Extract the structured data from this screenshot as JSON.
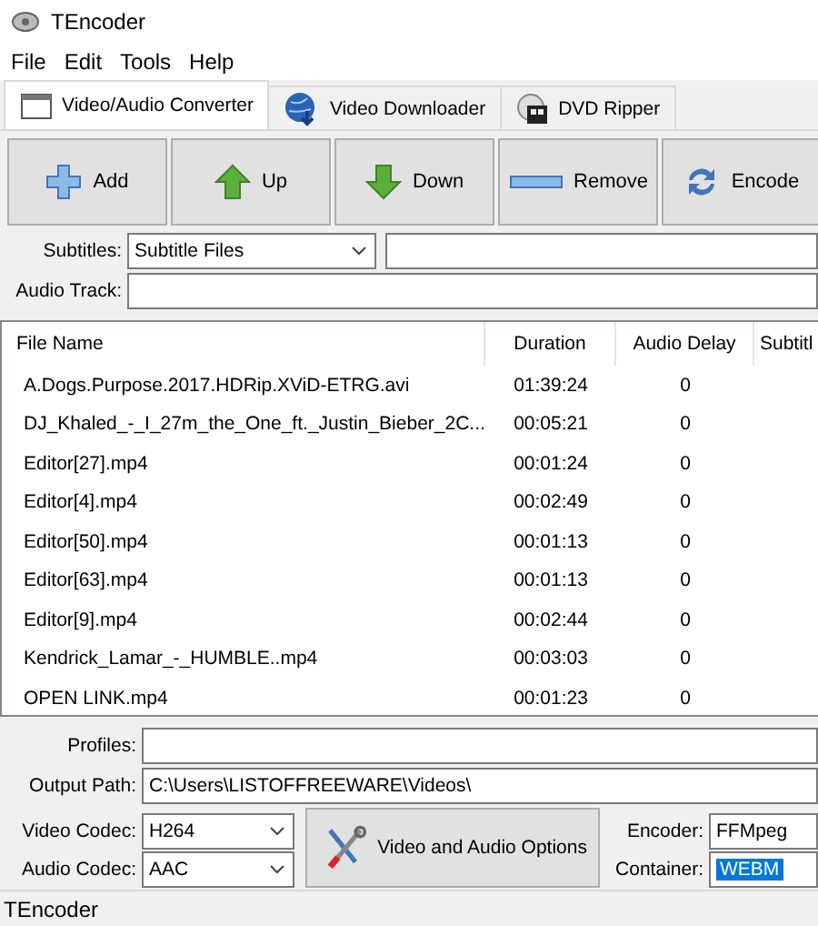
{
  "window": {
    "title": "TEncoder"
  },
  "menu": [
    "File",
    "Edit",
    "Tools",
    "Help"
  ],
  "tabs": [
    {
      "label": "Video/Audio Converter",
      "selected": true
    },
    {
      "label": "Video Downloader",
      "selected": false
    },
    {
      "label": "DVD Ripper",
      "selected": false
    }
  ],
  "toolbar": [
    {
      "label": "Add"
    },
    {
      "label": "Up"
    },
    {
      "label": "Down"
    },
    {
      "label": "Remove"
    },
    {
      "label": "Encode"
    }
  ],
  "subtitles": {
    "label": "Subtitles:",
    "value": "Subtitle Files"
  },
  "audio_track": {
    "label": "Audio Track:"
  },
  "table": {
    "columns": [
      "File Name",
      "Duration",
      "Audio Delay",
      "Subtitl"
    ],
    "rows": [
      [
        "A.Dogs.Purpose.2017.HDRip.XViD-ETRG.avi",
        "01:39:24",
        "0"
      ],
      [
        "DJ_Khaled_-_I_27m_the_One_ft._Justin_Bieber_2C...",
        "00:05:21",
        "0"
      ],
      [
        "Editor[27].mp4",
        "00:01:24",
        "0"
      ],
      [
        "Editor[4].mp4",
        "00:02:49",
        "0"
      ],
      [
        "Editor[50].mp4",
        "00:01:13",
        "0"
      ],
      [
        "Editor[63].mp4",
        "00:01:13",
        "0"
      ],
      [
        "Editor[9].mp4",
        "00:02:44",
        "0"
      ],
      [
        "Kendrick_Lamar_-_HUMBLE..mp4",
        "00:03:03",
        "0"
      ],
      [
        "OPEN LINK.mp4",
        "00:01:23",
        "0"
      ]
    ]
  },
  "profiles": {
    "label": "Profiles:"
  },
  "output_path": {
    "label": "Output Path:",
    "value": "C:\\Users\\LISTOFFREEWARE\\Videos\\"
  },
  "video_codec": {
    "label": "Video Codec:",
    "value": "H264"
  },
  "audio_codec": {
    "label": "Audio Codec:",
    "value": "AAC"
  },
  "options_button": "Video and Audio Options",
  "encoder": {
    "label": "Encoder:",
    "value": "FFMpeg"
  },
  "container": {
    "label": "Container:",
    "value": "WEBM",
    "highlighted": true
  },
  "status_bar": "TEncoder"
}
